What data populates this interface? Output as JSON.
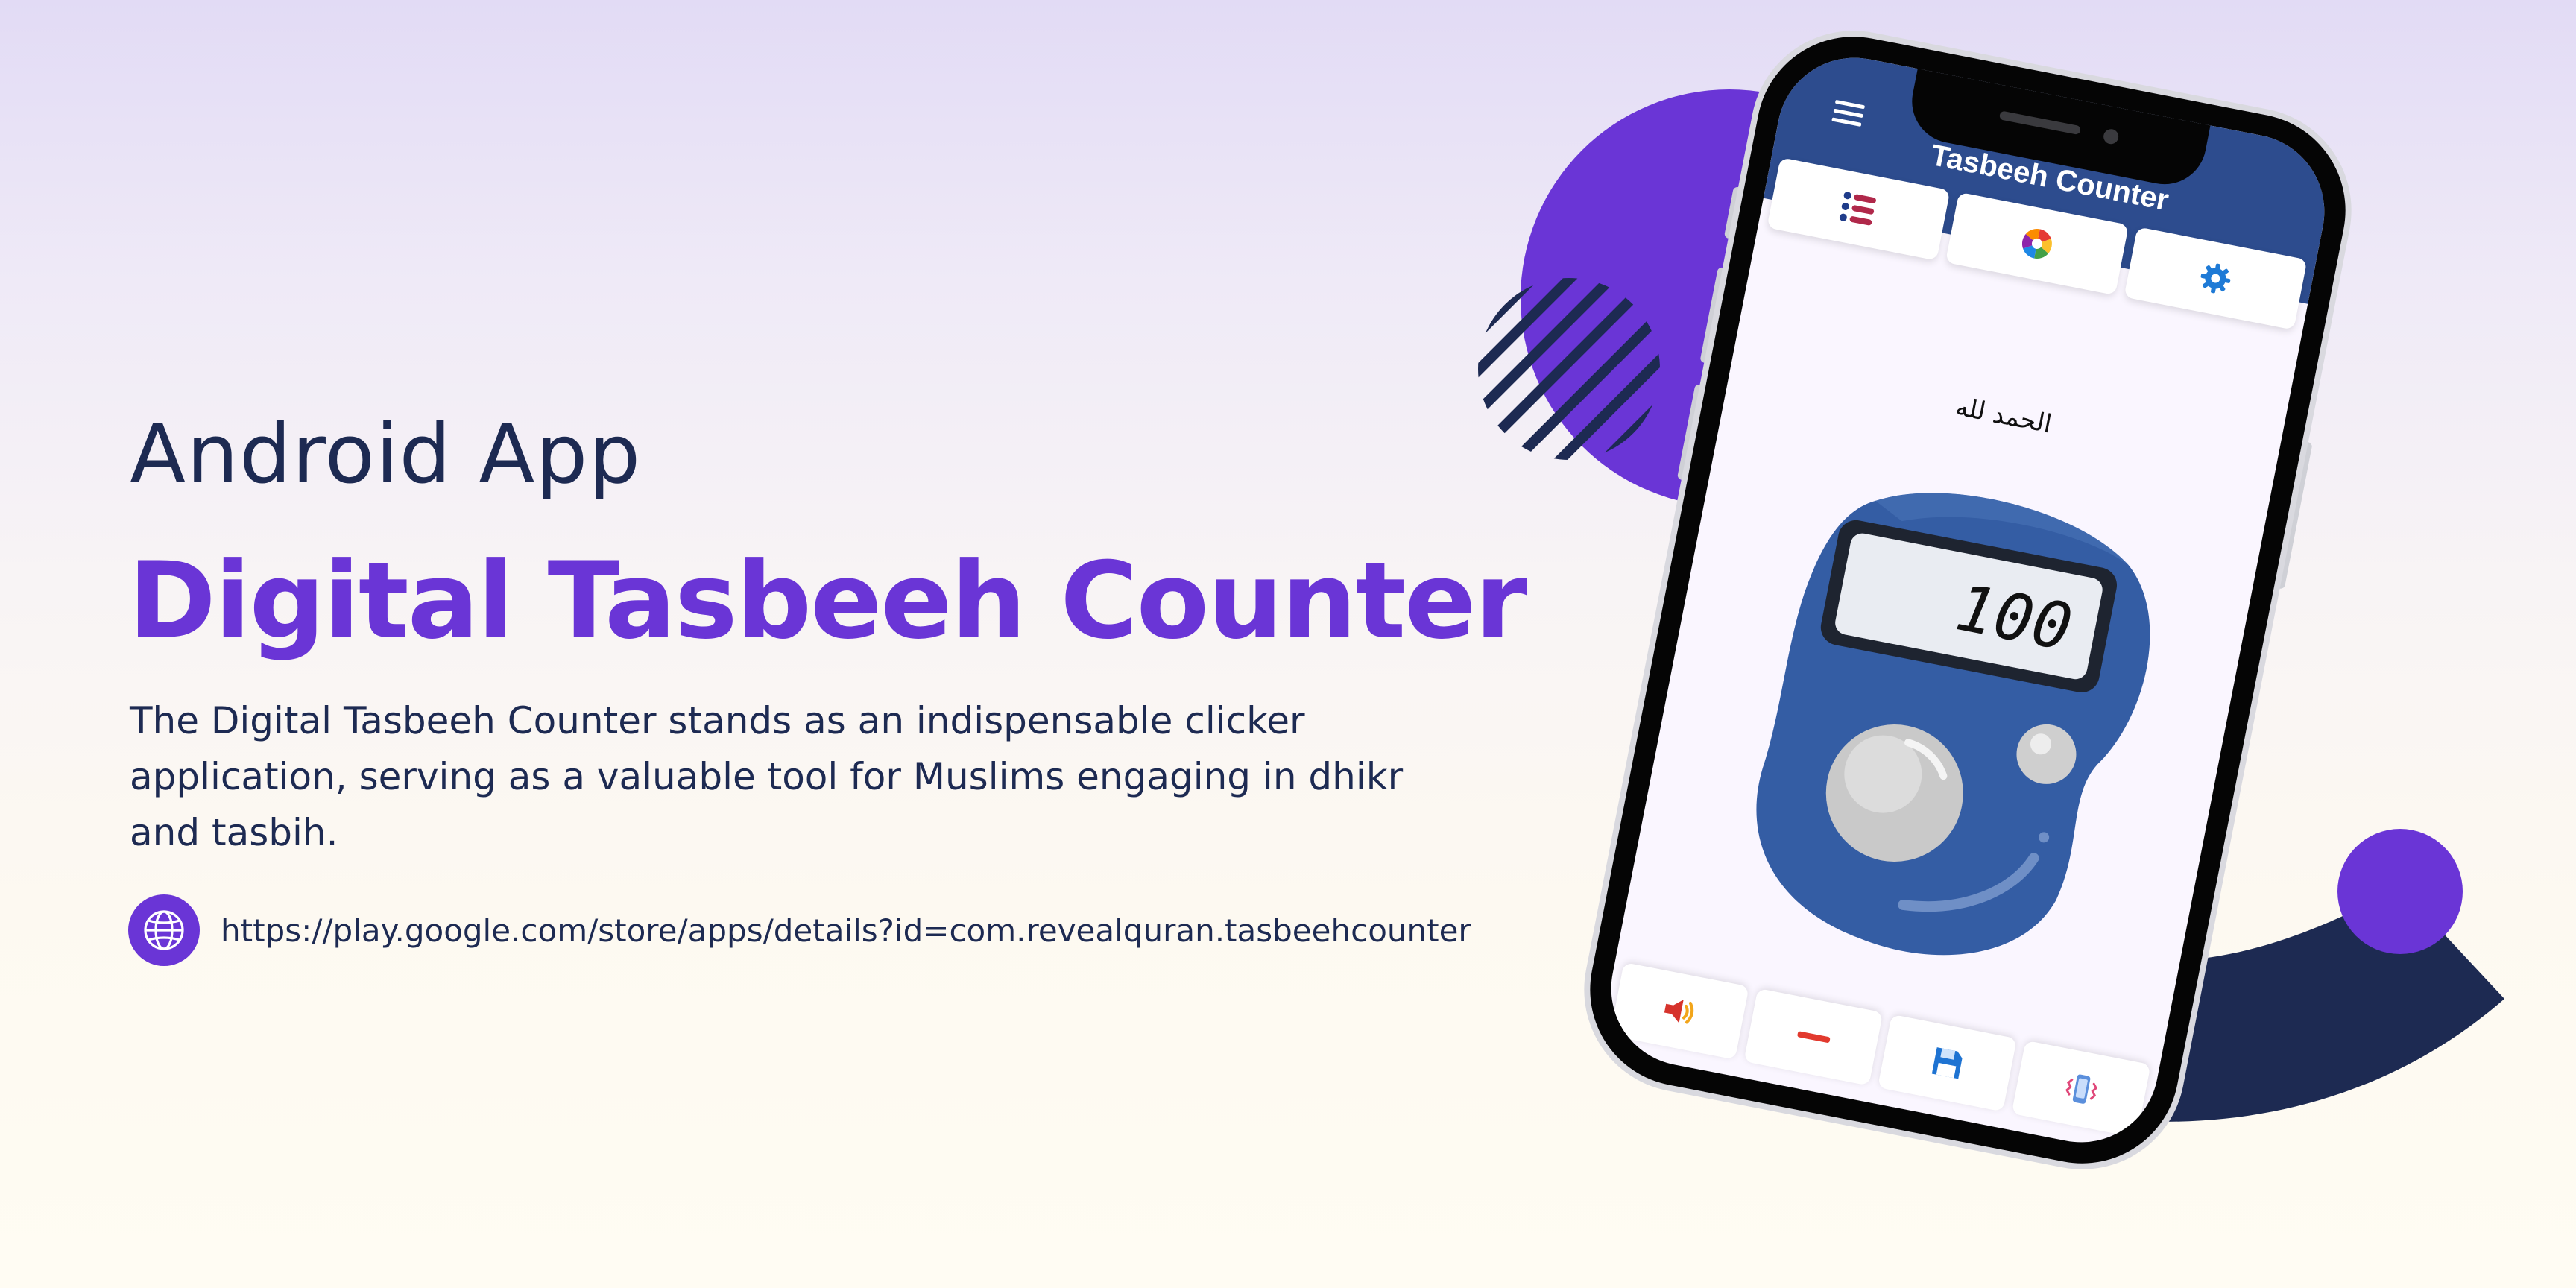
{
  "hero": {
    "eyebrow": "Android App",
    "headline": "Digital Tasbeeh Counter",
    "description": "The Digital Tasbeeh Counter stands as an indispensable clicker application, serving as a valuable tool for Muslims engaging in dhikr and tasbih.",
    "link_url": "https://play.google.com/store/apps/details?id=com.revealquran.tasbeehcounter"
  },
  "phone_app": {
    "title": "Tasbeeh Counter",
    "dhikr_text": "الحمد لله",
    "count": "100",
    "top_tabs": [
      {
        "icon": "list-icon"
      },
      {
        "icon": "color-wheel-icon"
      },
      {
        "icon": "gear-icon"
      }
    ],
    "bottom_tabs": [
      {
        "icon": "speaker-icon"
      },
      {
        "icon": "minus-icon"
      },
      {
        "icon": "save-icon"
      },
      {
        "icon": "vibrate-icon"
      }
    ]
  },
  "colors": {
    "accent_purple": "#6a35d6",
    "navy": "#1d2a52",
    "appbar_blue": "#2d4c8e",
    "counter_blue": "#345da4"
  }
}
